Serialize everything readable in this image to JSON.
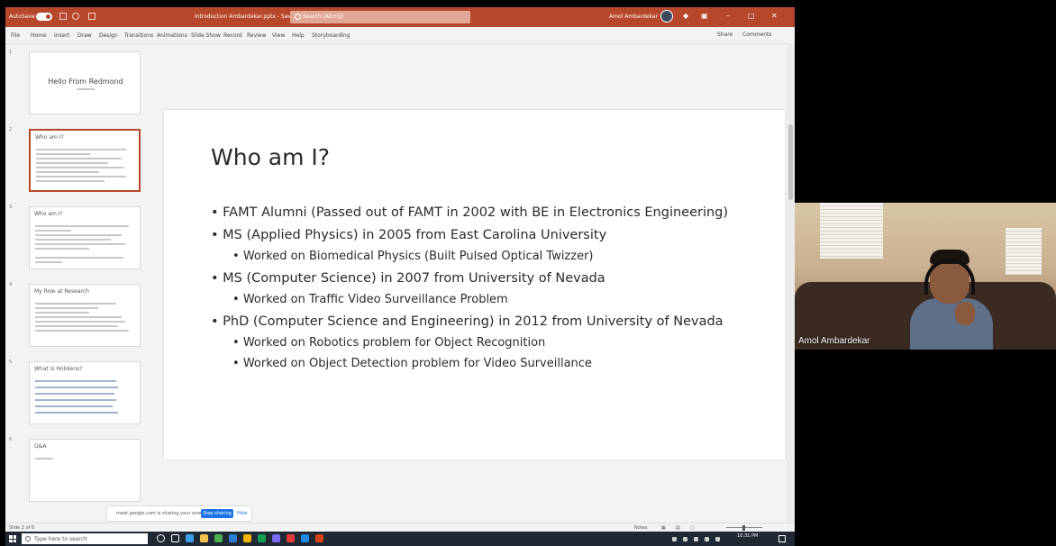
{
  "titlebar": {
    "autosave": "AutoSave",
    "doc_title": "Introduction Ambardekar.pptx - Saved",
    "search_placeholder": "Search (Alt+Q)",
    "user": "Amol Ambardekar"
  },
  "menu": [
    "File",
    "Home",
    "Insert",
    "Draw",
    "Design",
    "Transitions",
    "Animations",
    "Slide Show",
    "Record",
    "Review",
    "View",
    "Help",
    "Storyboarding"
  ],
  "share": {
    "share": "Share",
    "comments": "Comments"
  },
  "thumbnails": [
    {
      "num": "1",
      "title": "Hello From Redmond"
    },
    {
      "num": "2",
      "title": "Who am I?"
    },
    {
      "num": "3",
      "title": "Who am I?"
    },
    {
      "num": "4",
      "title": "My Role at Research"
    },
    {
      "num": "5",
      "title": "What is Hololens?"
    },
    {
      "num": "6",
      "title": "Q&A"
    }
  ],
  "slide": {
    "title": "Who am I?",
    "bullets": [
      {
        "level": 1,
        "text": "FAMT Alumni (Passed out of FAMT in 2002 with BE in Electronics Engineering)"
      },
      {
        "level": 1,
        "text": "MS (Applied Physics) in 2005 from East Carolina University"
      },
      {
        "level": 2,
        "text": "Worked on Biomedical Physics (Built Pulsed Optical Twizzer)"
      },
      {
        "level": 1,
        "text": "MS (Computer Science) in 2007 from University of Nevada"
      },
      {
        "level": 2,
        "text": "Worked on Traffic Video Surveillance  Problem"
      },
      {
        "level": 1,
        "text": "PhD (Computer Science and Engineering) in 2012 from University of Nevada"
      },
      {
        "level": 2,
        "text": "Worked on Robotics problem for Object Recognition"
      },
      {
        "level": 2,
        "text": "Worked on Object Detection problem for Video Surveillance"
      }
    ]
  },
  "sharing_bar": {
    "message": "meet.google.com is sharing your screen.",
    "stop": "Stop sharing",
    "hide": "Hide"
  },
  "statusbar": {
    "slide_info": "Slide 2 of 6",
    "notes": "Notes"
  },
  "taskbar": {
    "search_placeholder": "Type here to search",
    "time": "10:31 PM"
  },
  "video": {
    "participant": "Amol Ambardekar"
  },
  "colors": {
    "accent": "#b7472a",
    "taskbar": "#1f2833"
  }
}
